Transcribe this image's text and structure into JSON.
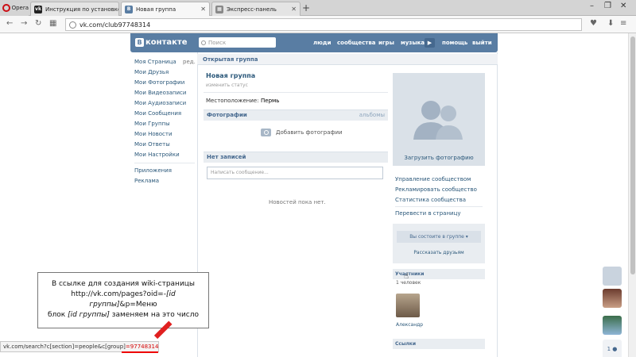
{
  "browser": {
    "menu_label": "Opera",
    "tabs": [
      {
        "label": "Инструкция по установке",
        "icon": "vk-icon"
      },
      {
        "label": "Новая группа",
        "icon": "vk-icon",
        "active": true
      },
      {
        "label": "Экспресс-панель",
        "icon": "speed-dial-icon"
      }
    ],
    "url": "vk.com/club97748314"
  },
  "vk_header": {
    "logo": "контакте",
    "search_placeholder": "Поиск",
    "menu": [
      "люди",
      "сообщества",
      "игры",
      "музыка",
      "помощь",
      "выйти"
    ]
  },
  "left_menu": {
    "edit_label": "ред.",
    "items": [
      "Моя Страница",
      "Мои Друзья",
      "Мои Фотографии",
      "Мои Видеозаписи",
      "Мои Аудиозаписи",
      "Мои Сообщения",
      "Мои Группы",
      "Мои Новости",
      "Мои Ответы",
      "Мои Настройки"
    ],
    "extra": [
      "Приложения",
      "Реклама"
    ]
  },
  "group": {
    "type_label": "Открытая группа",
    "name": "Новая группа",
    "status": "изменить статус",
    "location_label": "Местоположение:",
    "location_value": "Пермь",
    "photos_head": "Фотографии",
    "albums_label": "альбомы",
    "add_photos": "Добавить фотографии",
    "no_posts_head": "Нет записей",
    "message_placeholder": "Написать сообщение...",
    "no_news": "Новостей пока нет."
  },
  "right_col": {
    "upload_photo": "Загрузить фотографию",
    "links": [
      "Управление сообществом",
      "Рекламировать сообщество",
      "Статистика сообщества",
      "Перевести в страницу"
    ],
    "member_button": "Вы состоите в группе",
    "tell_friends": "Рассказать друзьям",
    "members_head": "Участники",
    "members_count": "1 человек",
    "member_name": "Александр",
    "links_head": "Ссылки"
  },
  "side_icons": {
    "count_label": "1"
  },
  "annotation": {
    "line1": "В ссылке для создания wiki-страницы",
    "line2a": "http://vk.com/pages?oid=-",
    "line2b": "[id группы]",
    "line2c": "&p=Меню",
    "line3a": "блок ",
    "line3b": "[id группы]",
    "line3c": " заменяем на это число"
  },
  "statusbar": {
    "text": "vk.com/search?c[section]=people&c[group]",
    "highlight": "=97748314"
  }
}
